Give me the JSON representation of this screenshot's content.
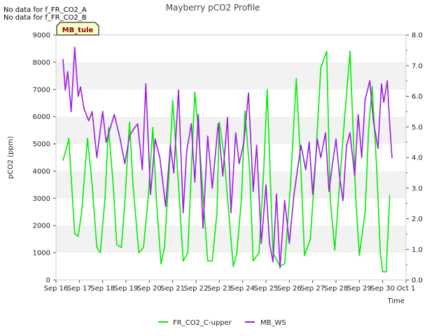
{
  "chart_data": {
    "type": "line",
    "title": "Mayberry pCO2 Profile",
    "notes": [
      "No data for f_FR_CO2_A",
      "No data for f_FR_CO2_B"
    ],
    "badge": "MB_tule",
    "xlabel": "Time",
    "ylabel": "pCO2 (ppm)",
    "x_ticks": [
      "Sep 16",
      "Sep 17",
      "Sep 18",
      "Sep 19",
      "Sep 20",
      "Sep 21",
      "Sep 22",
      "Sep 23",
      "Sep 24",
      "Sep 25",
      "Sep 26",
      "Sep 27",
      "Sep 28",
      "Sep 29",
      "Sep 30",
      "Oct 1"
    ],
    "xlim": [
      0,
      15
    ],
    "ylim": [
      0,
      9000
    ],
    "y_ticks": [
      0,
      1000,
      2000,
      3000,
      4000,
      5000,
      6000,
      7000,
      8000,
      9000
    ],
    "y2lim": [
      0,
      8
    ],
    "y2_ticks": [
      "0.0",
      "1.0",
      "2.0",
      "3.0",
      "4.0",
      "5.0",
      "6.0",
      "7.0",
      "8.0"
    ],
    "grid": "horizontal bands",
    "legend_position": "bottom",
    "series": [
      {
        "name": "FR_CO2_C-upper",
        "color": "#00ee00",
        "axis": "left",
        "x": [
          0.3,
          0.5,
          0.55,
          0.8,
          0.95,
          1.1,
          1.35,
          1.55,
          1.75,
          1.9,
          2.1,
          2.25,
          2.45,
          2.6,
          2.8,
          2.95,
          3.15,
          3.3,
          3.55,
          3.75,
          3.95,
          4.15,
          4.3,
          4.5,
          4.65,
          4.85,
          5.0,
          5.25,
          5.45,
          5.65,
          5.8,
          5.95,
          6.15,
          6.35,
          6.5,
          6.7,
          6.9,
          7.0,
          7.2,
          7.45,
          7.6,
          7.75,
          7.95,
          8.1,
          8.3,
          8.45,
          8.7,
          8.9,
          9.05,
          9.3,
          9.6,
          9.8,
          10.05,
          10.3,
          10.5,
          10.65,
          10.9,
          11.1,
          11.35,
          11.6,
          11.75,
          11.95,
          12.15,
          12.3,
          12.6,
          12.85,
          13.0,
          13.25,
          13.4,
          13.55,
          13.75,
          13.9,
          14.0,
          14.15,
          14.3
        ],
        "y": [
          4400,
          5000,
          5200,
          1700,
          1600,
          2500,
          5200,
          3500,
          1200,
          1000,
          3000,
          5600,
          3500,
          1300,
          1200,
          2800,
          5800,
          3500,
          1000,
          1200,
          3000,
          5600,
          3000,
          600,
          1200,
          4000,
          6600,
          3500,
          700,
          1000,
          4000,
          6900,
          5000,
          2500,
          700,
          700,
          2500,
          5800,
          4600,
          2000,
          500,
          1000,
          3000,
          6200,
          4000,
          700,
          1000,
          4000,
          7000,
          1000,
          500,
          600,
          3500,
          7400,
          4000,
          900,
          1500,
          4000,
          7800,
          8400,
          3000,
          1100,
          3500,
          5200,
          8400,
          3000,
          900,
          2500,
          5600,
          7100,
          4000,
          1000,
          300,
          300,
          3100
        ]
      },
      {
        "name": "MB_WS",
        "color": "#9a1ee0",
        "axis": "right",
        "x": [
          0.3,
          0.4,
          0.5,
          0.65,
          0.8,
          0.95,
          1.05,
          1.2,
          1.4,
          1.55,
          1.75,
          2.0,
          2.15,
          2.3,
          2.5,
          2.75,
          2.95,
          3.15,
          3.3,
          3.5,
          3.7,
          3.85,
          4.05,
          4.25,
          4.45,
          4.7,
          4.9,
          5.05,
          5.25,
          5.45,
          5.6,
          5.8,
          5.95,
          6.1,
          6.3,
          6.5,
          6.7,
          6.95,
          7.15,
          7.35,
          7.5,
          7.7,
          7.85,
          8.05,
          8.25,
          8.45,
          8.6,
          8.8,
          9.0,
          9.15,
          9.3,
          9.45,
          9.6,
          9.8,
          10.0,
          10.2,
          10.35,
          10.5,
          10.7,
          10.85,
          11.0,
          11.2,
          11.35,
          11.55,
          11.7,
          11.85,
          12.0,
          12.15,
          12.3,
          12.45,
          12.6,
          12.8,
          12.95,
          13.1,
          13.25,
          13.45,
          13.6,
          13.8,
          13.95,
          14.05,
          14.2,
          14.3,
          14.4
        ],
        "y": [
          7.2,
          6.2,
          6.8,
          5.5,
          7.6,
          6.0,
          6.3,
          5.6,
          5.2,
          5.5,
          4.0,
          5.5,
          4.5,
          4.9,
          5.4,
          4.6,
          3.8,
          4.7,
          4.9,
          5.1,
          3.6,
          6.4,
          2.8,
          4.6,
          4.0,
          2.4,
          4.4,
          3.5,
          6.2,
          2.2,
          4.2,
          5.1,
          3.2,
          5.4,
          1.7,
          4.7,
          3.0,
          5.1,
          3.4,
          5.3,
          2.2,
          4.8,
          3.8,
          4.5,
          6.1,
          2.9,
          4.4,
          1.2,
          3.1,
          1.2,
          0.6,
          2.8,
          0.4,
          2.6,
          1.2,
          2.8,
          3.6,
          4.4,
          3.6,
          4.5,
          2.8,
          4.6,
          4.0,
          4.8,
          2.9,
          3.8,
          4.6,
          3.4,
          2.6,
          4.4,
          4.8,
          3.4,
          5.4,
          4.0,
          5.9,
          6.5,
          5.2,
          4.3,
          6.4,
          5.8,
          6.5,
          5.1,
          4.0
        ]
      }
    ]
  }
}
